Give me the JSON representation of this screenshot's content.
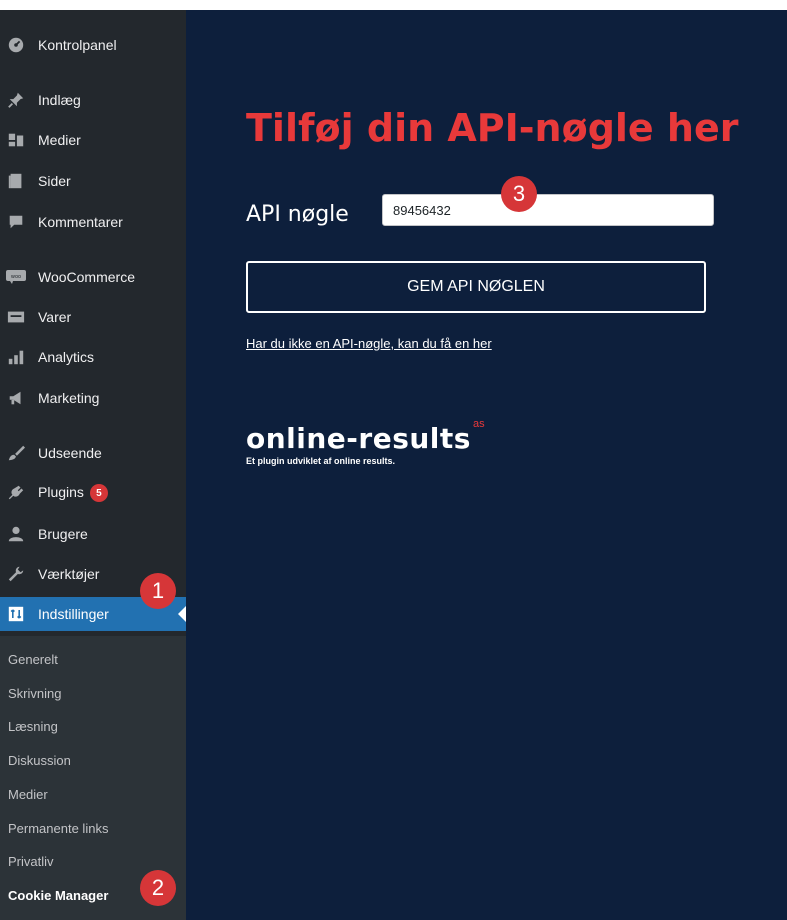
{
  "sidebar": {
    "items": [
      {
        "label": "Kontrolpanel",
        "icon": "dashboard-icon"
      },
      {
        "label": "Indlæg",
        "icon": "pin-icon"
      },
      {
        "label": "Medier",
        "icon": "media-icon"
      },
      {
        "label": "Sider",
        "icon": "page-icon"
      },
      {
        "label": "Kommentarer",
        "icon": "comment-icon"
      },
      {
        "label": "WooCommerce",
        "icon": "woocommerce-icon"
      },
      {
        "label": "Varer",
        "icon": "products-icon"
      },
      {
        "label": "Analytics",
        "icon": "analytics-icon"
      },
      {
        "label": "Marketing",
        "icon": "megaphone-icon"
      },
      {
        "label": "Udseende",
        "icon": "brush-icon"
      },
      {
        "label": "Plugins",
        "icon": "plugin-icon",
        "badge": "5"
      },
      {
        "label": "Brugere",
        "icon": "users-icon"
      },
      {
        "label": "Værktøjer",
        "icon": "wrench-icon"
      },
      {
        "label": "Indstillinger",
        "icon": "settings-icon",
        "active": true
      }
    ],
    "submenu": [
      {
        "label": "Generelt"
      },
      {
        "label": "Skrivning"
      },
      {
        "label": "Læsning"
      },
      {
        "label": "Diskussion"
      },
      {
        "label": "Medier"
      },
      {
        "label": "Permanente links"
      },
      {
        "label": "Privatliv"
      },
      {
        "label": "Cookie Manager",
        "current": true
      }
    ]
  },
  "steps": {
    "one": "1",
    "two": "2",
    "three": "3"
  },
  "main": {
    "title": "Tilføj din API-nøgle her",
    "api_label": "API nøgle",
    "api_value": "89456432",
    "save_button": "GEM API NØGLEN",
    "get_key_link": "Har du ikke en API-nøgle, kan du få en her",
    "logo_word": "online-results",
    "logo_suffix": "as",
    "logo_tagline": "Et plugin udviklet af online results."
  },
  "colors": {
    "sidebar_bg": "#23282d",
    "submenu_bg": "#2c3338",
    "active_bg": "#2271b1",
    "main_bg": "#0d1f3c",
    "title_red": "#e8393a",
    "badge_red": "#d63638"
  }
}
